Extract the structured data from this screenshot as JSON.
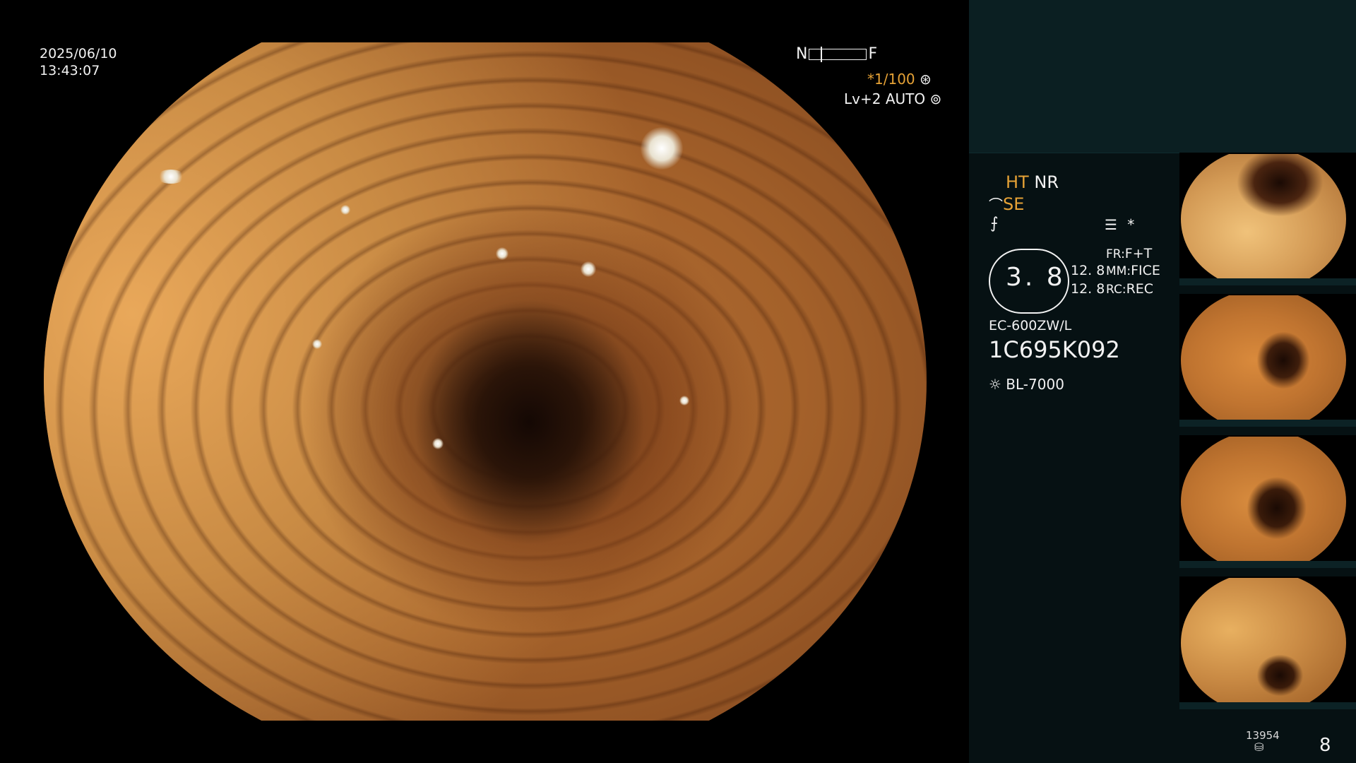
{
  "overlay": {
    "date": "2025/06/10",
    "time": "13:43:07",
    "near_label": "N",
    "far_label": "F",
    "shutter": "*1/100",
    "level": "Lv+2 AUTO"
  },
  "panel": {
    "ht": "HT",
    "nr": "NR",
    "se": "SE",
    "scale_value": "3. 8",
    "fr_label": "FR:",
    "fr_value": "F+T",
    "mm_label": "MM:",
    "mm_value": "FICE",
    "rc_label": "RC:",
    "rc_value": "REC",
    "val_top": "12. 8",
    "val_bottom": "12. 8",
    "scope_model": "EC-600ZW/L",
    "serial": "1C695K092",
    "light_source": "BL-7000",
    "asterisk": "*",
    "storage_count": "13954",
    "image_count": "8"
  },
  "colors": {
    "accent_amber": "#e6a236",
    "panel_bg": "#061113",
    "panel_top_bg": "#0b1f22"
  },
  "icons": {
    "shutter": "aperture-icon",
    "level": "iris-icon",
    "se": "structure-enhance-icon",
    "f": "flash-icon",
    "menu": "menu-list-icon",
    "light": "sun-lamp-icon",
    "storage": "database-icon"
  }
}
